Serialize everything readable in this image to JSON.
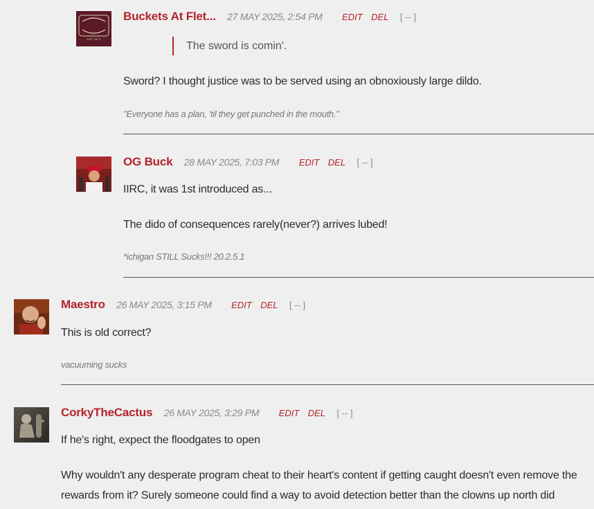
{
  "actions": {
    "edit": "EDIT",
    "del": "DEL",
    "collapse": "[ -- ]"
  },
  "comments": [
    {
      "author": "Buckets At Flet...",
      "date": "27 MAY 2025, 2:54 PM",
      "quote": "The sword is comin'.",
      "paragraphs": [
        "Sword?  I thought justice was to be served using an obnoxiously large dildo."
      ],
      "signature": "\"Everyone has a plan, 'til they get punched in the mouth.\"",
      "avatar": "mother-buckets-logo",
      "avatar_text": "MOTHER BUCKETS"
    },
    {
      "author": "OG Buck",
      "date": "28 MAY 2025, 7:03 PM",
      "paragraphs": [
        "IIRC, it was 1st introduced as...",
        "The dido of consequences rarely(never?) arrives lubed!"
      ],
      "signature": "*ichigan STILL Sucks!!! 20.2.5.1",
      "avatar": "person-red-cap-photo"
    },
    {
      "author": "Maestro",
      "date": "26 MAY 2025, 3:15 PM",
      "paragraphs": [
        "This is old correct?"
      ],
      "signature": "vacuuming sucks",
      "avatar": "smiling-monk-photo"
    },
    {
      "author": "CorkyTheCactus",
      "date": "26 MAY 2025, 3:29 PM",
      "paragraphs": [
        "If he's right, expect the floodgates to open",
        "Why wouldn't any desperate program cheat to their heart's content if getting caught doesn't even remove the rewards from it? Surely someone could find a way to avoid detection better than the clowns up north did"
      ],
      "avatar": "cactus-statue-photo"
    }
  ],
  "colors": {
    "accent": "#b3232c",
    "background": "#efefef",
    "text": "#2b2b2b",
    "muted": "#888888"
  }
}
